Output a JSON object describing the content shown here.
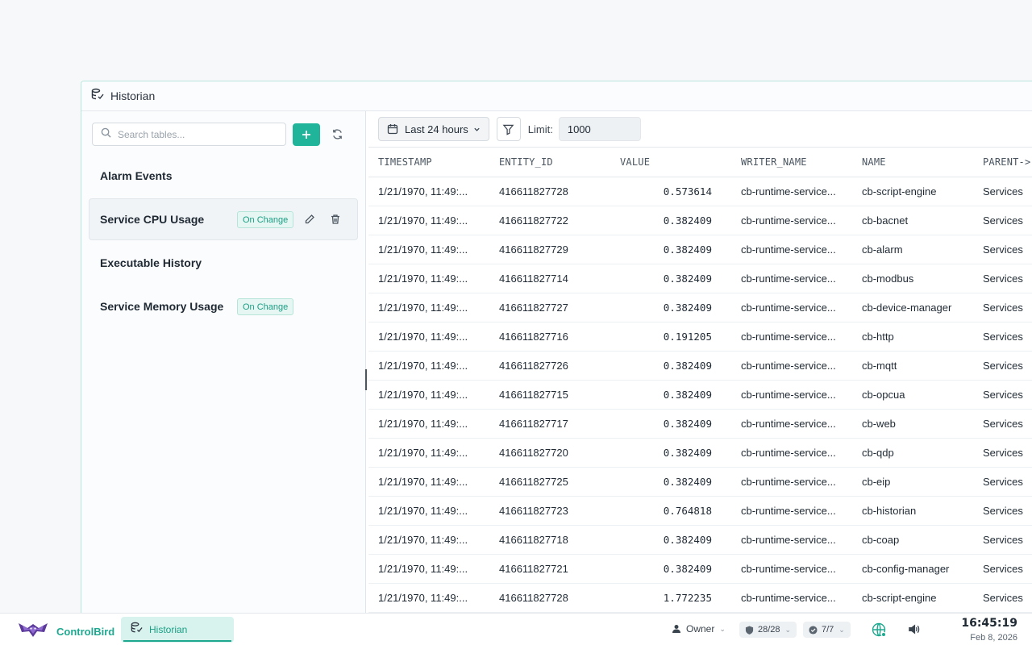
{
  "window": {
    "title": "Historian"
  },
  "sidebar": {
    "search_placeholder": "Search tables...",
    "tables": [
      {
        "name": "Alarm Events",
        "badge": "",
        "active": false
      },
      {
        "name": "Service CPU Usage",
        "badge": "On Change",
        "active": true
      },
      {
        "name": "Executable History",
        "badge": "",
        "active": false
      },
      {
        "name": "Service Memory Usage",
        "badge": "On Change",
        "active": false
      }
    ]
  },
  "toolbar": {
    "range_label": "Last 24 hours",
    "limit_label": "Limit:",
    "limit_value": "1000"
  },
  "table": {
    "columns": [
      "TIMESTAMP",
      "ENTITY_ID",
      "VALUE",
      "WRITER_NAME",
      "NAME",
      "PARENT->"
    ],
    "rows": [
      [
        "1/21/1970, 11:49:...",
        "416611827728",
        "0.573614",
        "cb-runtime-service...",
        "cb-script-engine",
        "Services"
      ],
      [
        "1/21/1970, 11:49:...",
        "416611827722",
        "0.382409",
        "cb-runtime-service...",
        "cb-bacnet",
        "Services"
      ],
      [
        "1/21/1970, 11:49:...",
        "416611827729",
        "0.382409",
        "cb-runtime-service...",
        "cb-alarm",
        "Services"
      ],
      [
        "1/21/1970, 11:49:...",
        "416611827714",
        "0.382409",
        "cb-runtime-service...",
        "cb-modbus",
        "Services"
      ],
      [
        "1/21/1970, 11:49:...",
        "416611827727",
        "0.382409",
        "cb-runtime-service...",
        "cb-device-manager",
        "Services"
      ],
      [
        "1/21/1970, 11:49:...",
        "416611827716",
        "0.191205",
        "cb-runtime-service...",
        "cb-http",
        "Services"
      ],
      [
        "1/21/1970, 11:49:...",
        "416611827726",
        "0.382409",
        "cb-runtime-service...",
        "cb-mqtt",
        "Services"
      ],
      [
        "1/21/1970, 11:49:...",
        "416611827715",
        "0.382409",
        "cb-runtime-service...",
        "cb-opcua",
        "Services"
      ],
      [
        "1/21/1970, 11:49:...",
        "416611827717",
        "0.382409",
        "cb-runtime-service...",
        "cb-web",
        "Services"
      ],
      [
        "1/21/1970, 11:49:...",
        "416611827720",
        "0.382409",
        "cb-runtime-service...",
        "cb-qdp",
        "Services"
      ],
      [
        "1/21/1970, 11:49:...",
        "416611827725",
        "0.382409",
        "cb-runtime-service...",
        "cb-eip",
        "Services"
      ],
      [
        "1/21/1970, 11:49:...",
        "416611827723",
        "0.764818",
        "cb-runtime-service...",
        "cb-historian",
        "Services"
      ],
      [
        "1/21/1970, 11:49:...",
        "416611827718",
        "0.382409",
        "cb-runtime-service...",
        "cb-coap",
        "Services"
      ],
      [
        "1/21/1970, 11:49:...",
        "416611827721",
        "0.382409",
        "cb-runtime-service...",
        "cb-config-manager",
        "Services"
      ],
      [
        "1/21/1970, 11:49:...",
        "416611827728",
        "1.772235",
        "cb-runtime-service...",
        "cb-script-engine",
        "Services"
      ]
    ]
  },
  "taskbar": {
    "brand": "ControlBird",
    "task_label": "Historian",
    "user": "Owner",
    "services_count": "28/28",
    "checks_count": "7/7",
    "time": "16:45:19",
    "date": "Feb 8, 2026"
  },
  "colors": {
    "accent": "#20b59a",
    "badge_text": "#1a9e84",
    "badge_bg": "#e6f6f2"
  }
}
